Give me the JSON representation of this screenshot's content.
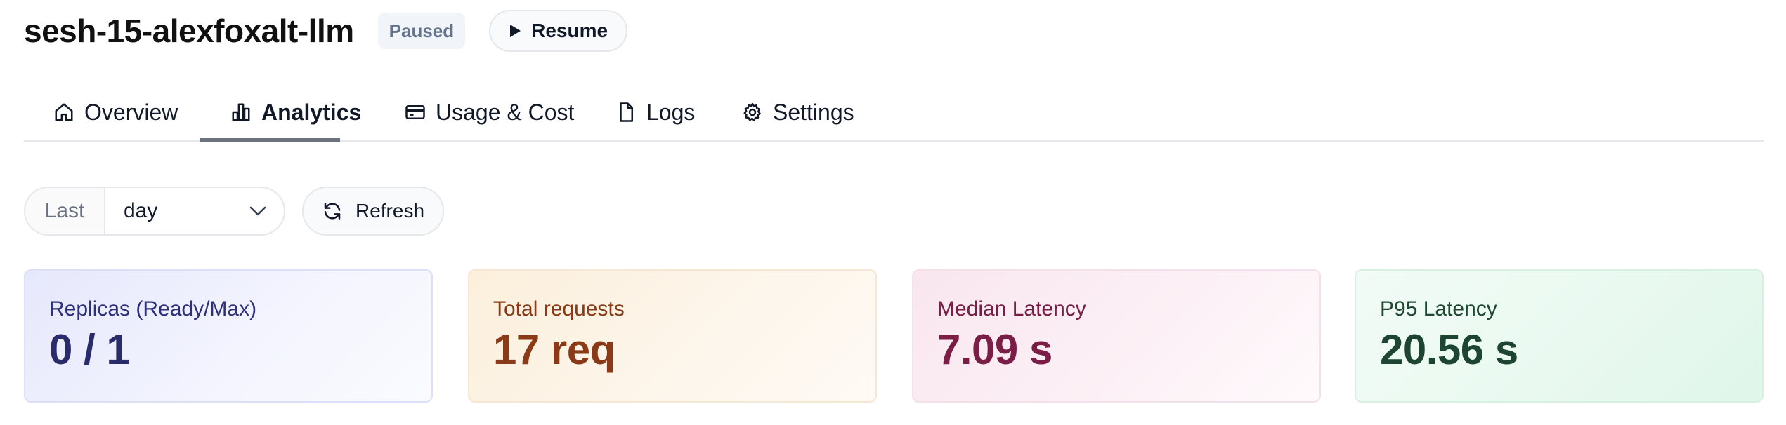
{
  "header": {
    "title": "sesh-15-alexfoxalt-llm",
    "status_badge": "Paused",
    "resume_label": "Resume"
  },
  "tabs": [
    {
      "label": "Overview",
      "icon": "home-icon",
      "active": false
    },
    {
      "label": "Analytics",
      "icon": "bar-chart-icon",
      "active": true
    },
    {
      "label": "Usage & Cost",
      "icon": "credit-card-icon",
      "active": false
    },
    {
      "label": "Logs",
      "icon": "file-icon",
      "active": false
    },
    {
      "label": "Settings",
      "icon": "gear-icon",
      "active": false
    }
  ],
  "controls": {
    "range_prefix": "Last",
    "range_value": "day",
    "refresh_label": "Refresh"
  },
  "stats": [
    {
      "label": "Replicas (Ready/Max)",
      "value": "0 / 1",
      "label_color": "#2e2f7a",
      "value_color": "#2a2b6b"
    },
    {
      "label": "Total requests",
      "value": "17 req",
      "label_color": "#8a3a14",
      "value_color": "#8b3a17"
    },
    {
      "label": "Median Latency",
      "value": "7.09 s",
      "label_color": "#7a1d45",
      "value_color": "#7b1e45"
    },
    {
      "label": "P95 Latency",
      "value": "20.56 s",
      "label_color": "#1f4733",
      "value_color": "#1e4532"
    }
  ],
  "colors": {
    "active_tab_underline": "#6b7280",
    "border": "#e5e7eb",
    "card_backgrounds": [
      "#eef0fd",
      "#fdf3e6",
      "#fbeef4",
      "#e8f8ef"
    ]
  }
}
